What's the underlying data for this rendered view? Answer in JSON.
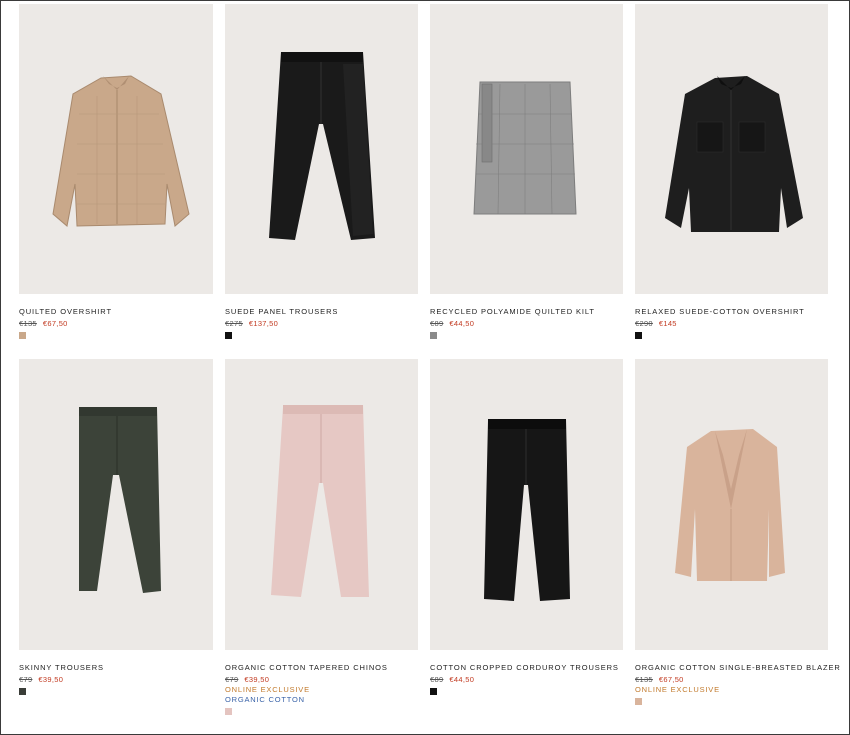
{
  "products": [
    {
      "name": "QUILTED OVERSHIRT",
      "old_price": "€135",
      "new_price": "€67,50",
      "tags": [],
      "swatch_color": "#c9a88a",
      "image_icon": "shirt-icon"
    },
    {
      "name": "SUEDE PANEL TROUSERS",
      "old_price": "€275",
      "new_price": "€137,50",
      "tags": [],
      "swatch_color": "#111111",
      "image_icon": "trousers-icon"
    },
    {
      "name": "RECYCLED POLYAMIDE QUILTED KILT",
      "old_price": "€89",
      "new_price": "€44,50",
      "tags": [],
      "swatch_color": "#8a8a8a",
      "image_icon": "kilt-icon"
    },
    {
      "name": "RELAXED SUEDE-COTTON OVERSHIRT",
      "old_price": "€290",
      "new_price": "€145",
      "tags": [],
      "swatch_color": "#111111",
      "image_icon": "shirt-icon"
    },
    {
      "name": "SKINNY TROUSERS",
      "old_price": "€79",
      "new_price": "€39,50",
      "tags": [],
      "swatch_color": "#3a3d38",
      "image_icon": "trousers-icon"
    },
    {
      "name": "ORGANIC COTTON TAPERED CHINOS",
      "old_price": "€79",
      "new_price": "€39,50",
      "tags": [
        "ONLINE EXCLUSIVE",
        "ORGANIC COTTON"
      ],
      "swatch_color": "#e4c4c0",
      "image_icon": "trousers-icon"
    },
    {
      "name": "COTTON CROPPED CORDUROY TROUSERS",
      "old_price": "€89",
      "new_price": "€44,50",
      "tags": [],
      "swatch_color": "#111111",
      "image_icon": "trousers-icon"
    },
    {
      "name": "ORGANIC COTTON SINGLE-BREASTED BLAZER",
      "old_price": "€135",
      "new_price": "€67,50",
      "tags": [
        "ONLINE EXCLUSIVE"
      ],
      "swatch_color": "#d9b49c",
      "image_icon": "blazer-icon"
    }
  ]
}
